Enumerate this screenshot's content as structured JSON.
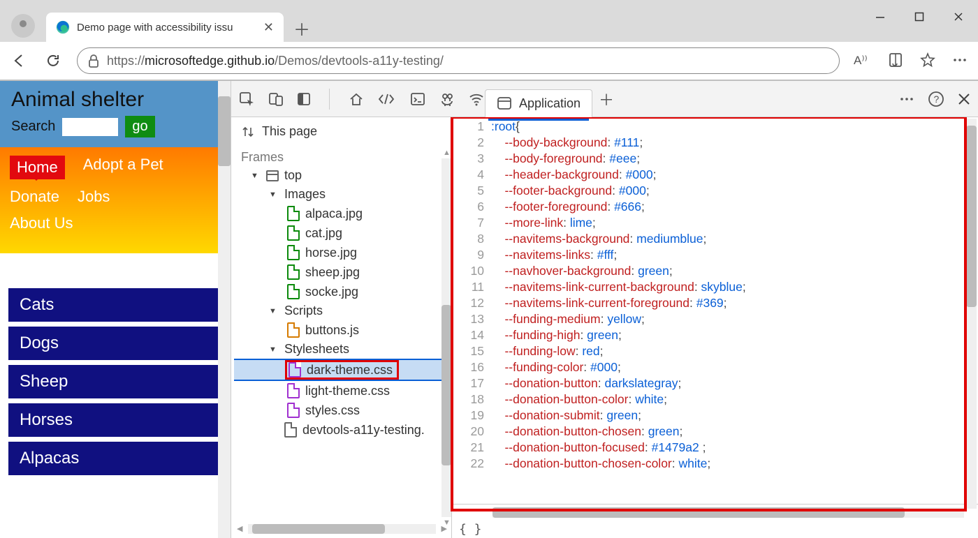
{
  "browser": {
    "tab_title": "Demo page with accessibility issu",
    "url_prefix": "https://",
    "url_host": "microsoftedge.github.io",
    "url_path": "/Demos/devtools-a11y-testing/"
  },
  "page": {
    "title": "Animal shelter",
    "search_label": "Search",
    "go_btn": "go",
    "nav": {
      "home": "Home",
      "adopt": "Adopt a Pet",
      "donate": "Donate",
      "jobs": "Jobs",
      "about": "About Us"
    },
    "categories": [
      "Cats",
      "Dogs",
      "Sheep",
      "Horses",
      "Alpacas"
    ]
  },
  "devtools": {
    "this_page": "This page",
    "active_tab": "Application",
    "frames_label": "Frames",
    "tree": {
      "top": "top",
      "images_label": "Images",
      "images": [
        "alpaca.jpg",
        "cat.jpg",
        "horse.jpg",
        "sheep.jpg",
        "socke.jpg"
      ],
      "scripts_label": "Scripts",
      "scripts": [
        "buttons.js"
      ],
      "styles_label": "Stylesheets",
      "styles": [
        "dark-theme.css",
        "light-theme.css",
        "styles.css"
      ],
      "html_file": "devtools-a11y-testing."
    },
    "braces": "{ }",
    "code": [
      {
        "ln": 1,
        "sel": ":root",
        "punct": "{"
      },
      {
        "ln": 2,
        "prop": "--body-background",
        "val": "#111"
      },
      {
        "ln": 3,
        "prop": "--body-foreground",
        "val": "#eee"
      },
      {
        "ln": 4,
        "prop": "--header-background",
        "val": "#000"
      },
      {
        "ln": 5,
        "prop": "--footer-background",
        "val": "#000"
      },
      {
        "ln": 6,
        "prop": "--footer-foreground",
        "val": "#666"
      },
      {
        "ln": 7,
        "prop": "--more-link",
        "val": "lime"
      },
      {
        "ln": 8,
        "prop": "--navitems-background",
        "val": "mediumblue"
      },
      {
        "ln": 9,
        "prop": "--navitems-links",
        "val": "#fff"
      },
      {
        "ln": 10,
        "prop": "--navhover-background",
        "val": "green"
      },
      {
        "ln": 11,
        "prop": "--navitems-link-current-background",
        "val": "skyblue"
      },
      {
        "ln": 12,
        "prop": "--navitems-link-current-foreground",
        "val": "#369"
      },
      {
        "ln": 13,
        "prop": "--funding-medium",
        "val": "yellow"
      },
      {
        "ln": 14,
        "prop": "--funding-high",
        "val": "green"
      },
      {
        "ln": 15,
        "prop": "--funding-low",
        "val": "red"
      },
      {
        "ln": 16,
        "prop": "--funding-color",
        "val": "#000"
      },
      {
        "ln": 17,
        "prop": "--donation-button",
        "val": "darkslategray"
      },
      {
        "ln": 18,
        "prop": "--donation-button-color",
        "val": "white"
      },
      {
        "ln": 19,
        "prop": "--donation-submit",
        "val": "green"
      },
      {
        "ln": 20,
        "prop": "--donation-button-chosen",
        "val": "green"
      },
      {
        "ln": 21,
        "prop": "--donation-button-focused",
        "val": "#1479a2 "
      },
      {
        "ln": 22,
        "prop": "--donation-button-chosen-color",
        "val": "white"
      }
    ]
  }
}
